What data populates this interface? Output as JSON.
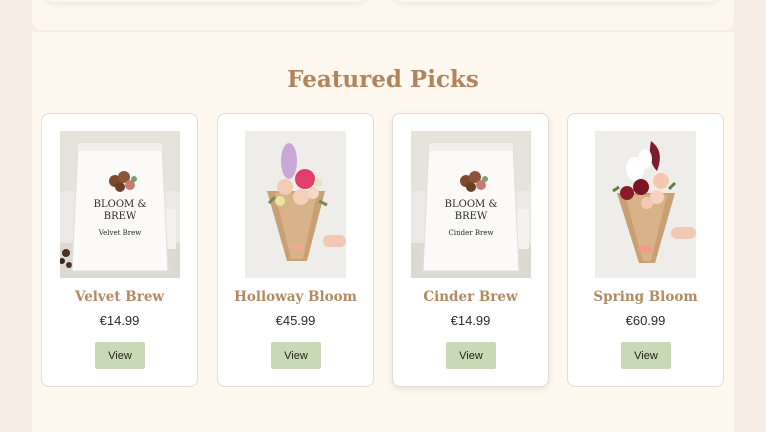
{
  "section": {
    "title": "Featured Picks"
  },
  "colors": {
    "accent": "#b0855b",
    "button": "#c8d9b5",
    "background": "#f8ece6",
    "panel": "#fef8ee"
  },
  "products": [
    {
      "name": "Velvet Brew",
      "price": "€14.99",
      "button_label": "View",
      "image": "coffee-bag-image",
      "bag_brand": "BLOOM &\nBREW",
      "bag_variant": "Velvet Brew"
    },
    {
      "name": "Holloway Bloom",
      "price": "€45.99",
      "button_label": "View",
      "image": "flower-bouquet-image"
    },
    {
      "name": "Cinder Brew",
      "price": "€14.99",
      "button_label": "View",
      "image": "coffee-bag-image",
      "bag_brand": "BLOOM &\nBREW",
      "bag_variant": "Cinder Brew"
    },
    {
      "name": "Spring Bloom",
      "price": "€60.99",
      "button_label": "View",
      "image": "flower-bouquet-image"
    }
  ]
}
